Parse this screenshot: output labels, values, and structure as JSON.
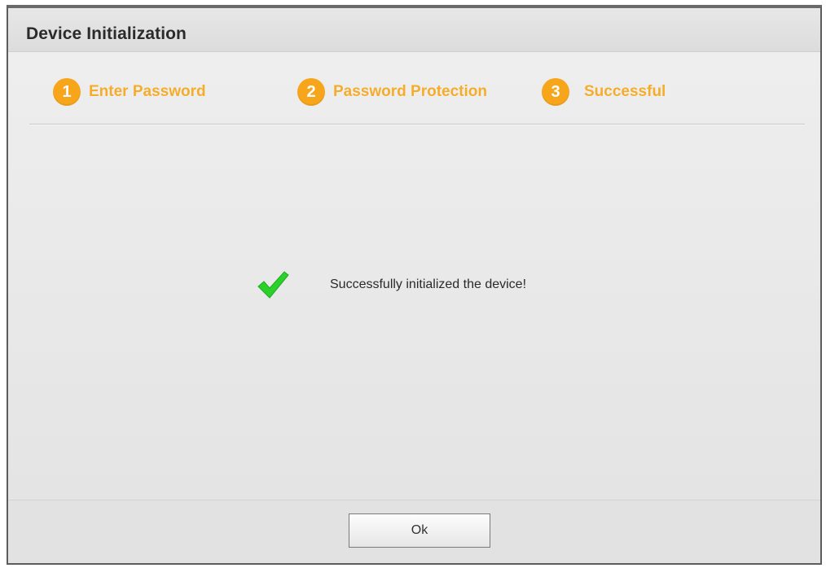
{
  "dialog": {
    "title": "Device Initialization"
  },
  "steps": [
    {
      "number": "1",
      "label": "Enter Password"
    },
    {
      "number": "2",
      "label": "Password Protection"
    },
    {
      "number": "3",
      "label": "Successful"
    }
  ],
  "message": {
    "icon": "checkmark-icon",
    "text": "Successfully initialized the device!"
  },
  "footer": {
    "ok_label": "Ok"
  },
  "colors": {
    "step_accent": "#f7a51a",
    "success_check": "#2bd12b"
  }
}
